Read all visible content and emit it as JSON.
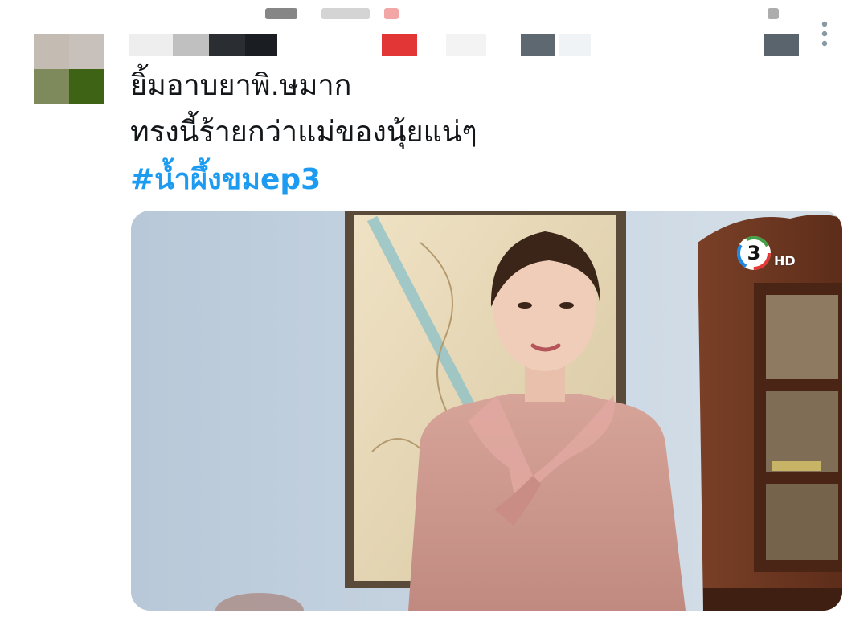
{
  "tweet": {
    "lines": [
      "ยิ้มอาบยาพิ.ษมาก",
      "ทรงนี้ร้ายกว่าแม่ของนุ้ยแน่ๆ"
    ],
    "hashtag": "#น้ำผึ้งขมep3"
  },
  "media": {
    "channel_logo_number": "3",
    "channel_logo_suffix": "HD"
  },
  "icons": {
    "more": "more-vertical-icon"
  },
  "colors": {
    "hashtag": "#1d9bf0",
    "text": "#14171a",
    "icon_gray": "#8899a6"
  }
}
